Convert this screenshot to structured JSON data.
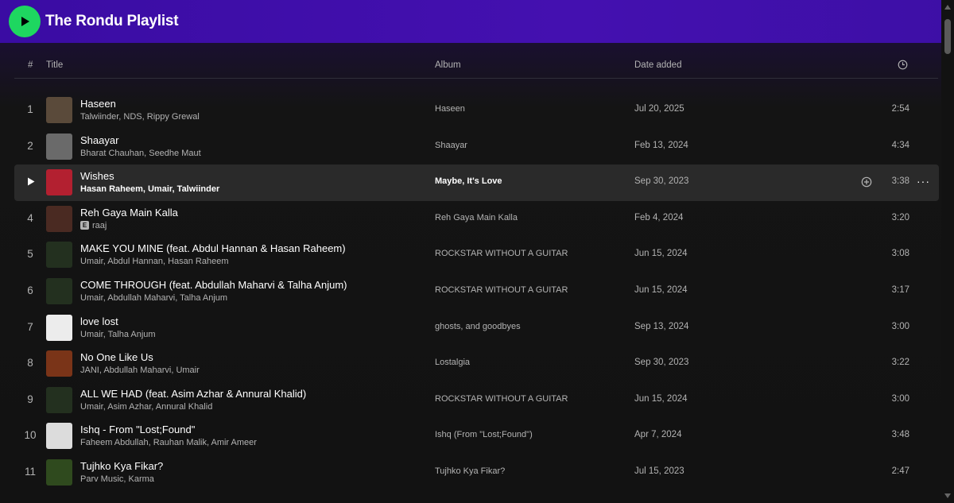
{
  "playlist": {
    "title": "The Rondu Playlist"
  },
  "columns": {
    "num": "#",
    "title": "Title",
    "album": "Album",
    "date": "Date added"
  },
  "colors": {
    "accent": "#1ed760",
    "header": "#3a0ca3"
  },
  "icons": {
    "play": "play-icon",
    "duration": "clock-icon",
    "add": "add-circle-icon",
    "more": "more-icon"
  },
  "tracks": [
    {
      "num": "1",
      "title": "Haseen",
      "artist": "Talwiinder, NDS, Rippy Grewal",
      "album": "Haseen",
      "date": "Jul 20, 2025",
      "duration": "2:54",
      "thumb": "#5a4a3a"
    },
    {
      "num": "2",
      "title": "Shaayar",
      "artist": "Bharat Chauhan, Seedhe Maut",
      "album": "Shaayar",
      "date": "Feb 13, 2024",
      "duration": "4:34",
      "thumb": "#6a6a6a"
    },
    {
      "num": "3",
      "title": "Wishes",
      "artist": "Hasan Raheem, Umair, Talwiinder",
      "album": "Maybe, It's Love",
      "date": "Sep 30, 2023",
      "duration": "3:38",
      "thumb": "#b32030",
      "active": true
    },
    {
      "num": "4",
      "title": "Reh Gaya Main Kalla",
      "artist": "raaj",
      "album": "Reh Gaya Main Kalla",
      "date": "Feb 4, 2024",
      "duration": "3:20",
      "thumb": "#4a2a22",
      "explicit": "E"
    },
    {
      "num": "5",
      "title": "MAKE YOU MINE (feat. Abdul Hannan & Hasan Raheem)",
      "artist": "Umair, Abdul Hannan, Hasan Raheem",
      "album": "ROCKSTAR WITHOUT A GUITAR",
      "date": "Jun 15, 2024",
      "duration": "3:08",
      "thumb": "#23301f"
    },
    {
      "num": "6",
      "title": "COME THROUGH (feat. Abdullah Maharvi & Talha Anjum)",
      "artist": "Umair, Abdullah Maharvi, Talha Anjum",
      "album": "ROCKSTAR WITHOUT A GUITAR",
      "date": "Jun 15, 2024",
      "duration": "3:17",
      "thumb": "#23301f"
    },
    {
      "num": "7",
      "title": "love lost",
      "artist": "Umair, Talha Anjum",
      "album": "ghosts, and goodbyes",
      "date": "Sep 13, 2024",
      "duration": "3:00",
      "thumb": "#ececec"
    },
    {
      "num": "8",
      "title": "No One Like Us",
      "artist": "JANI, Abdullah Maharvi, Umair",
      "album": "Lostalgia",
      "date": "Sep 30, 2023",
      "duration": "3:22",
      "thumb": "#7a3418"
    },
    {
      "num": "9",
      "title": "ALL WE HAD (feat. Asim Azhar & Annural Khalid)",
      "artist": "Umair, Asim Azhar, Annural Khalid",
      "album": "ROCKSTAR WITHOUT A GUITAR",
      "date": "Jun 15, 2024",
      "duration": "3:00",
      "thumb": "#23301f"
    },
    {
      "num": "10",
      "title": "Ishq - From \"Lost;Found\"",
      "artist": "Faheem Abdullah, Rauhan Malik, Amir Ameer",
      "album": "Ishq (From \"Lost;Found\")",
      "date": "Apr 7, 2024",
      "duration": "3:48",
      "thumb": "#dcdcdc"
    },
    {
      "num": "11",
      "title": "Tujhko Kya Fikar?",
      "artist": "Parv Music, Karma",
      "album": "Tujhko Kya Fikar?",
      "date": "Jul 15, 2023",
      "duration": "2:47",
      "thumb": "#2f4a1e"
    }
  ]
}
